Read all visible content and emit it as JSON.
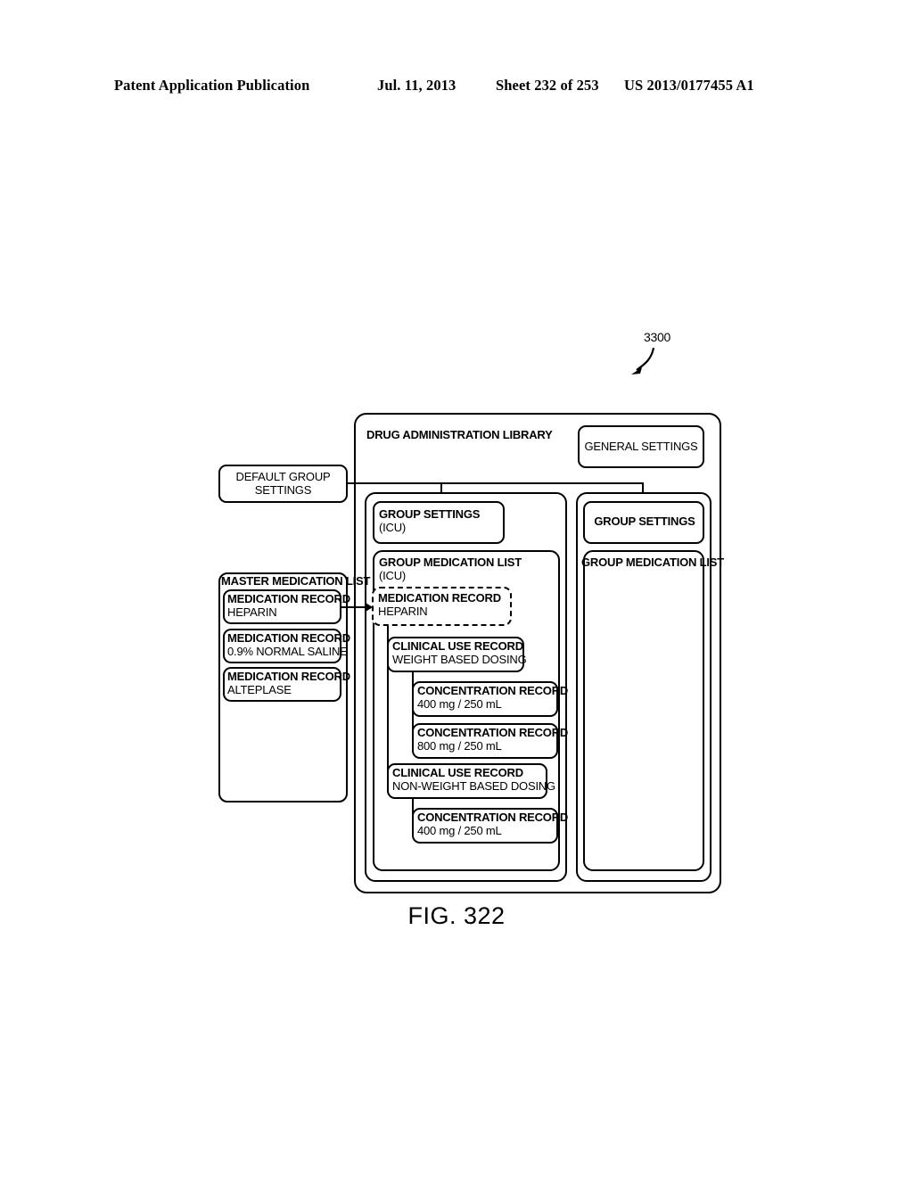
{
  "header": {
    "publication": "Patent Application Publication",
    "date": "Jul. 11, 2013",
    "sheet": "Sheet 232 of 253",
    "patent_number": "US 2013/0177455 A1"
  },
  "figure": {
    "reference_numeral": "3300",
    "caption": "FIG. 322"
  },
  "diagram": {
    "library": {
      "title": "DRUG ADMINISTRATION LIBRARY"
    },
    "general_settings": {
      "title": "GENERAL SETTINGS"
    },
    "default_group_settings": {
      "line1": "DEFAULT GROUP",
      "line2": "SETTINGS"
    },
    "master_medication_list": {
      "title": "MASTER MEDICATION LIST",
      "records": [
        {
          "title": "MEDICATION RECORD",
          "value": "HEPARIN"
        },
        {
          "title": "MEDICATION RECORD",
          "value": "0.9% NORMAL SALINE"
        },
        {
          "title": "MEDICATION RECORD",
          "value": "ALTEPLASE"
        }
      ]
    },
    "group_icu": {
      "settings": {
        "title": "GROUP SETTINGS",
        "value": "(ICU)"
      },
      "medication_list": {
        "title": "GROUP MEDICATION LIST",
        "value": "(ICU)"
      },
      "medication_record": {
        "title": "MEDICATION RECORD",
        "value": "HEPARIN"
      },
      "clinical_use_records": [
        {
          "title": "CLINICAL USE RECORD",
          "value": "WEIGHT BASED DOSING",
          "concentrations": [
            {
              "title": "CONCENTRATION RECORD",
              "value": "400 mg / 250 mL"
            },
            {
              "title": "CONCENTRATION RECORD",
              "value": "800 mg / 250 mL"
            }
          ]
        },
        {
          "title": "CLINICAL USE RECORD",
          "value": "NON-WEIGHT BASED DOSING",
          "concentrations": [
            {
              "title": "CONCENTRATION RECORD",
              "value": "400 mg / 250 mL"
            }
          ]
        }
      ]
    },
    "group_empty": {
      "settings": {
        "title": "GROUP SETTINGS"
      },
      "medication_list": {
        "title": "GROUP MEDICATION LIST"
      }
    }
  }
}
